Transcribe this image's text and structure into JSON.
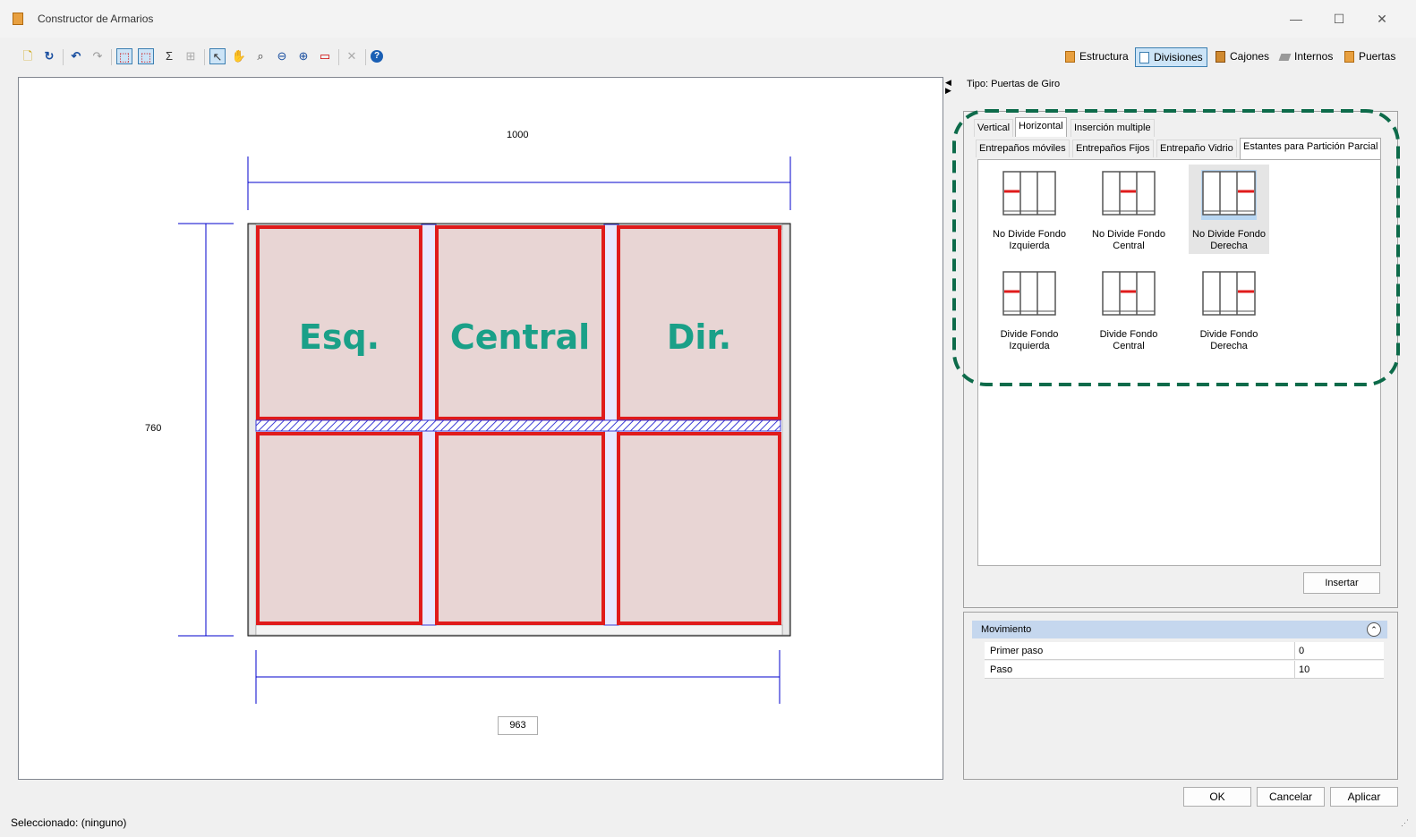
{
  "window": {
    "title": "Constructor de Armarios",
    "min": "—",
    "max": "☐",
    "close": "✕"
  },
  "modules": [
    "Estructura",
    "Divisiones",
    "Cajones",
    "Internos",
    "Puertas"
  ],
  "drawing": {
    "width_dim": "1000",
    "height_dim": "760",
    "inner_width_dim": "963",
    "bay_labels": [
      "Esq.",
      "Central",
      "Dir."
    ]
  },
  "right_panel": {
    "tipo": "Tipo: Puertas de Giro",
    "tabs_row1": [
      "Vertical",
      "Horizontal",
      "Inserción multiple"
    ],
    "tabs_row2": [
      "Entrepaños móviles",
      "Entrepaños Fijos",
      "Entrepaño Vidrio",
      "Estantes para Partición Parcial"
    ],
    "items": [
      {
        "label": "No Divide Fondo Izquierda",
        "pos": "left"
      },
      {
        "label": "No Divide Fondo Central",
        "pos": "center"
      },
      {
        "label": "No Divide Fondo Derecha",
        "pos": "right"
      },
      {
        "label": "Divide Fondo Izquierda",
        "pos": "left"
      },
      {
        "label": "Divide Fondo Central",
        "pos": "center"
      },
      {
        "label": "Divide Fondo Derecha",
        "pos": "right"
      }
    ],
    "insert_label": "Insertar"
  },
  "movimiento": {
    "header": "Movimiento",
    "toggle": "⌃",
    "rows": [
      {
        "name": "Primer paso",
        "value": "0"
      },
      {
        "name": "Paso",
        "value": "10"
      }
    ]
  },
  "buttons": {
    "ok": "OK",
    "cancel": "Cancelar",
    "apply": "Aplicar"
  },
  "status": "Seleccionado: (ninguno)",
  "colors": {
    "panel_red": "#e01b1b",
    "bay_fill": "#e8d5d4",
    "label_teal": "#1aa088",
    "highlight_green": "#0d6b4a",
    "dim_blue": "#0000cc"
  }
}
